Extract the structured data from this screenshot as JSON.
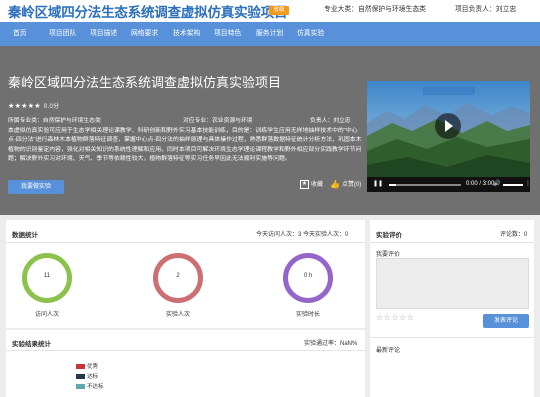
{
  "header": {
    "title": "秦岭区域四分法生态系统调查虚拟仿真实验项目",
    "level_badge": "省级",
    "major_category": "专业大类：自然保护与环境生态类",
    "owner": "项目负责人：刘立忠"
  },
  "nav": [
    "首页",
    "项目团队",
    "项目描述",
    "网络要求",
    "技术架构",
    "项目特色",
    "服务计划",
    "仿真实验"
  ],
  "hero": {
    "title": "秦岭区域四分法生态系统调查虚拟仿真实验项目",
    "stars": "★★★★★",
    "score": "0.0分",
    "major": "所属专业类：自然保护与环境生态类",
    "target_major": "对应专业：农业资源与环境",
    "owner": "负责人：刘立忠",
    "description": "本虚拟仿真实验可应用于生态学相关理论课教学、科研创新和野外实习基本技能训练，目的是：训练学生应用无样地抽样技术中的\"中心点-四分法\"进行森林木本植物群落特征调查，掌握中心点-四分法的抽样原理与具体操作过程，熟悉群落数据特征统计分析方法，巩固本木植物的识别鉴定内容，强化对相关知识的系统性理解和应用。同时本项目可解决环境生态学理论课程教学和野外相应部分实践教学环节问题；解决野外实习对环境、天气、季节等依赖性较大，植物群落特征等实习任务早因此无法顺利实施等问题。",
    "enter_button": "我要做实验",
    "favorite": "收藏",
    "like": "点赞(0)"
  },
  "video": {
    "time": "0:00 / 3:00",
    "progress": 0.1
  },
  "stats": {
    "title": "数据统计",
    "today": "今天访问人次：3  今天实验人次：0",
    "rings": [
      {
        "value": "11",
        "label": "访问人次",
        "color": "#8cc14c"
      },
      {
        "value": "2",
        "label": "实验人次",
        "color": "#cc6f73"
      },
      {
        "value": "0 h",
        "label": "实验时长",
        "color": "#9466cc"
      }
    ]
  },
  "results": {
    "title": "实验结果统计",
    "pass_rate": "实验通过率：NaN%",
    "legend": [
      {
        "label": "优秀",
        "color": "#c8343a"
      },
      {
        "label": "达标",
        "color": "#28364d"
      },
      {
        "label": "不达标",
        "color": "#5fa7a8"
      }
    ]
  },
  "evaluation": {
    "title": "实验评价",
    "count": "评论数：0",
    "my_eval": "我要评价",
    "stars": "☆☆☆☆☆",
    "publish": "发表评论",
    "latest": "最新评论"
  },
  "colors": {
    "brand": "#2c6fbe",
    "nav": "#5891d9",
    "badge": "#f39a1e",
    "dot_active": "#e97b26",
    "dot_inactive": "#f3a468"
  },
  "icons": [
    "star-icon",
    "like-icon",
    "play-icon",
    "pause-icon",
    "volume-icon",
    "more-icon"
  ]
}
